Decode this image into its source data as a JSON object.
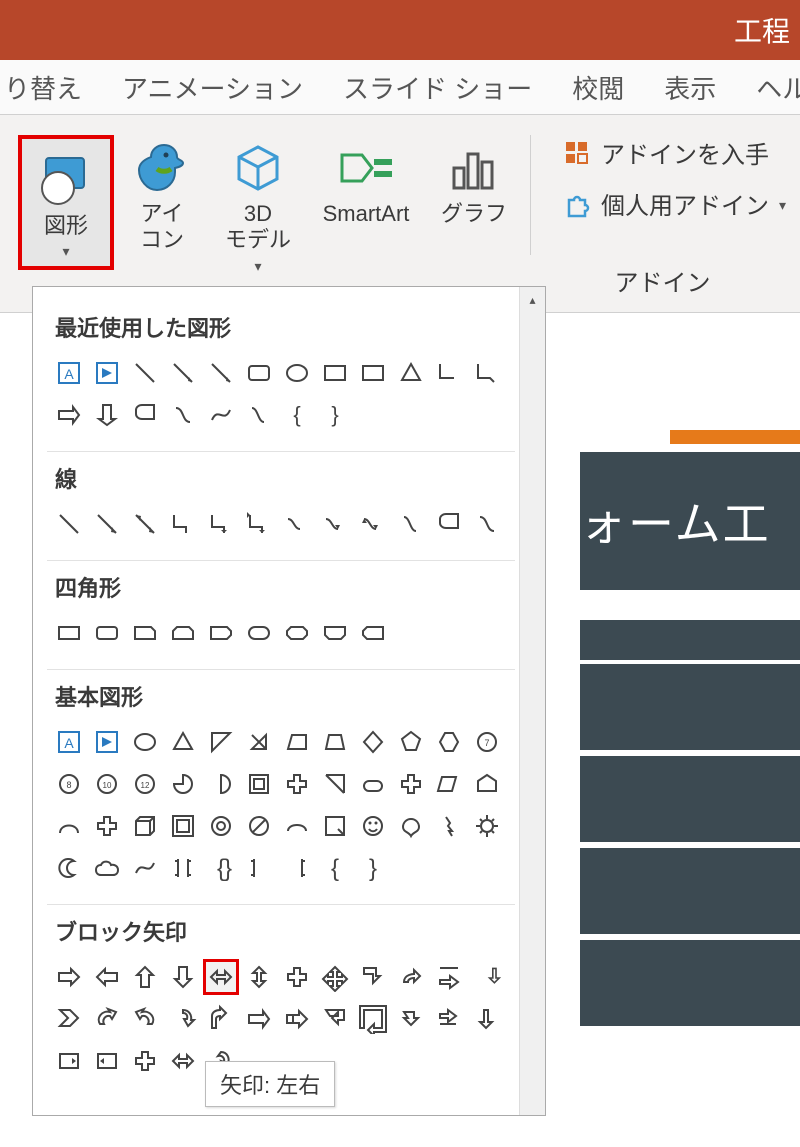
{
  "title_partial": "工程",
  "tabs": [
    "り替え",
    "アニメーション",
    "スライド ショー",
    "校閲",
    "表示",
    "ヘル"
  ],
  "ribbon": {
    "shapes": "図形",
    "icons": "アイ\nコン",
    "models3d": "3D\nモデル",
    "smartart": "SmartArt",
    "chart": "グラフ",
    "get_addins": "アドインを入手",
    "my_addins": "個人用アドイン",
    "addins_group": "アドイン"
  },
  "dropdown": {
    "cat_recent": "最近使用した図形",
    "cat_lines": "線",
    "cat_rects": "四角形",
    "cat_basic": "基本図形",
    "cat_block_arrows": "ブロック矢印",
    "tooltip_text": "矢印: 左右"
  },
  "slide": {
    "title_partial": "ォーム工"
  }
}
